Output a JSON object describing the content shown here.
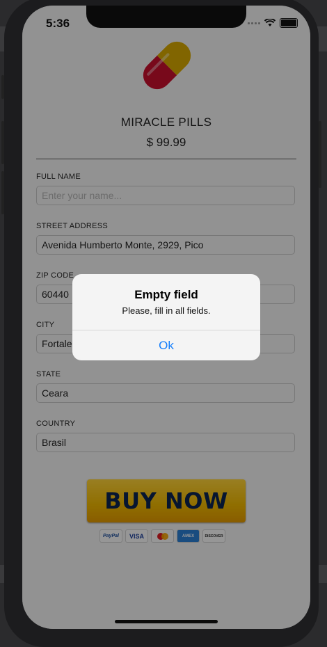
{
  "status_bar": {
    "time": "5:36"
  },
  "product": {
    "name": "MIRACLE PILLS",
    "price": "$ 99.99"
  },
  "form": {
    "fields": [
      {
        "label": "FULL NAME",
        "value": "",
        "placeholder": "Enter your name..."
      },
      {
        "label": "STREET ADDRESS",
        "value": "Avenida Humberto Monte, 2929, Pico",
        "placeholder": ""
      },
      {
        "label": "ZIP CODE",
        "value": "60440",
        "placeholder": ""
      },
      {
        "label": "CITY",
        "value": "Fortaleza",
        "placeholder": ""
      },
      {
        "label": "STATE",
        "value": "Ceara",
        "placeholder": ""
      },
      {
        "label": "COUNTRY",
        "value": "Brasil",
        "placeholder": ""
      }
    ]
  },
  "buy_button": {
    "label": "BUY NOW"
  },
  "payment_methods": [
    "PayPal",
    "VISA",
    "",
    "AMEX",
    "DISCOVER"
  ],
  "alert": {
    "title": "Empty field",
    "message": "Please, fill in all fields.",
    "button": "Ok"
  },
  "colors": {
    "accent": "#147efb",
    "buy_button": "#f0b800",
    "pill_red": "#c8102e",
    "pill_yellow": "#d8a800"
  }
}
